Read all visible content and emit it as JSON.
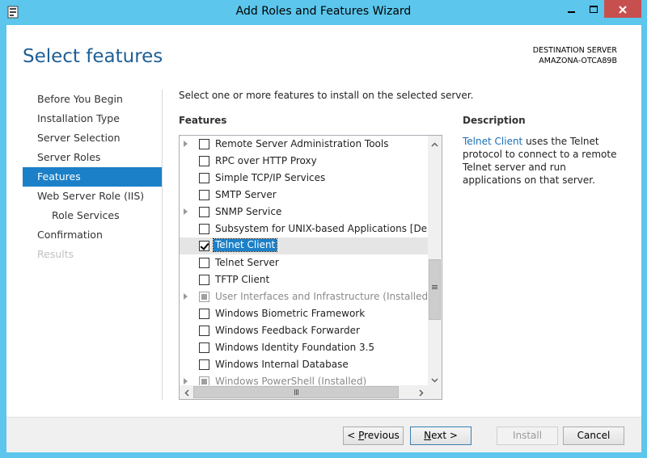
{
  "window": {
    "title": "Add Roles and Features Wizard",
    "accent": "#5cc6ec",
    "close_color": "#c7504f"
  },
  "header": {
    "page_title": "Select features",
    "destination_label": "DESTINATION SERVER",
    "destination_value": "AMAZONA-OTCA89B"
  },
  "nav": {
    "items": [
      {
        "label": "Before You Begin",
        "state": "normal"
      },
      {
        "label": "Installation Type",
        "state": "normal"
      },
      {
        "label": "Server Selection",
        "state": "normal"
      },
      {
        "label": "Server Roles",
        "state": "normal"
      },
      {
        "label": "Features",
        "state": "active"
      },
      {
        "label": "Web Server Role (IIS)",
        "state": "normal"
      },
      {
        "label": "Role Services",
        "state": "sub"
      },
      {
        "label": "Confirmation",
        "state": "normal"
      },
      {
        "label": "Results",
        "state": "disabled"
      }
    ]
  },
  "main": {
    "instruction": "Select one or more features to install on the selected server.",
    "features_label": "Features",
    "features": [
      {
        "label": "Remote Server Administration Tools",
        "expandable": true,
        "checked": false,
        "disabled": false
      },
      {
        "label": "RPC over HTTP Proxy",
        "expandable": false,
        "checked": false,
        "disabled": false
      },
      {
        "label": "Simple TCP/IP Services",
        "expandable": false,
        "checked": false,
        "disabled": false
      },
      {
        "label": "SMTP Server",
        "expandable": false,
        "checked": false,
        "disabled": false
      },
      {
        "label": "SNMP Service",
        "expandable": true,
        "checked": false,
        "disabled": false
      },
      {
        "label": "Subsystem for UNIX-based Applications [Deprecated]",
        "expandable": false,
        "checked": false,
        "disabled": false
      },
      {
        "label": "Telnet Client",
        "expandable": false,
        "checked": true,
        "disabled": false,
        "selected": true
      },
      {
        "label": "Telnet Server",
        "expandable": false,
        "checked": false,
        "disabled": false
      },
      {
        "label": "TFTP Client",
        "expandable": false,
        "checked": false,
        "disabled": false
      },
      {
        "label": "User Interfaces and Infrastructure (Installed)",
        "expandable": true,
        "checked": false,
        "disabled": true
      },
      {
        "label": "Windows Biometric Framework",
        "expandable": false,
        "checked": false,
        "disabled": false
      },
      {
        "label": "Windows Feedback Forwarder",
        "expandable": false,
        "checked": false,
        "disabled": false
      },
      {
        "label": "Windows Identity Foundation 3.5",
        "expandable": false,
        "checked": false,
        "disabled": false
      },
      {
        "label": "Windows Internal Database",
        "expandable": false,
        "checked": false,
        "disabled": false
      },
      {
        "label": "Windows PowerShell (Installed)",
        "expandable": true,
        "checked": false,
        "disabled": true
      }
    ]
  },
  "description": {
    "label": "Description",
    "link_text": "Telnet Client",
    "text": " uses the Telnet protocol to connect to a remote Telnet server and run applications on that server."
  },
  "footer": {
    "previous_prefix": "< ",
    "previous_hotkey": "P",
    "previous_rest": "revious",
    "next_hotkey": "N",
    "next_rest": "ext >",
    "install_label": "Install",
    "cancel_label": "Cancel"
  }
}
